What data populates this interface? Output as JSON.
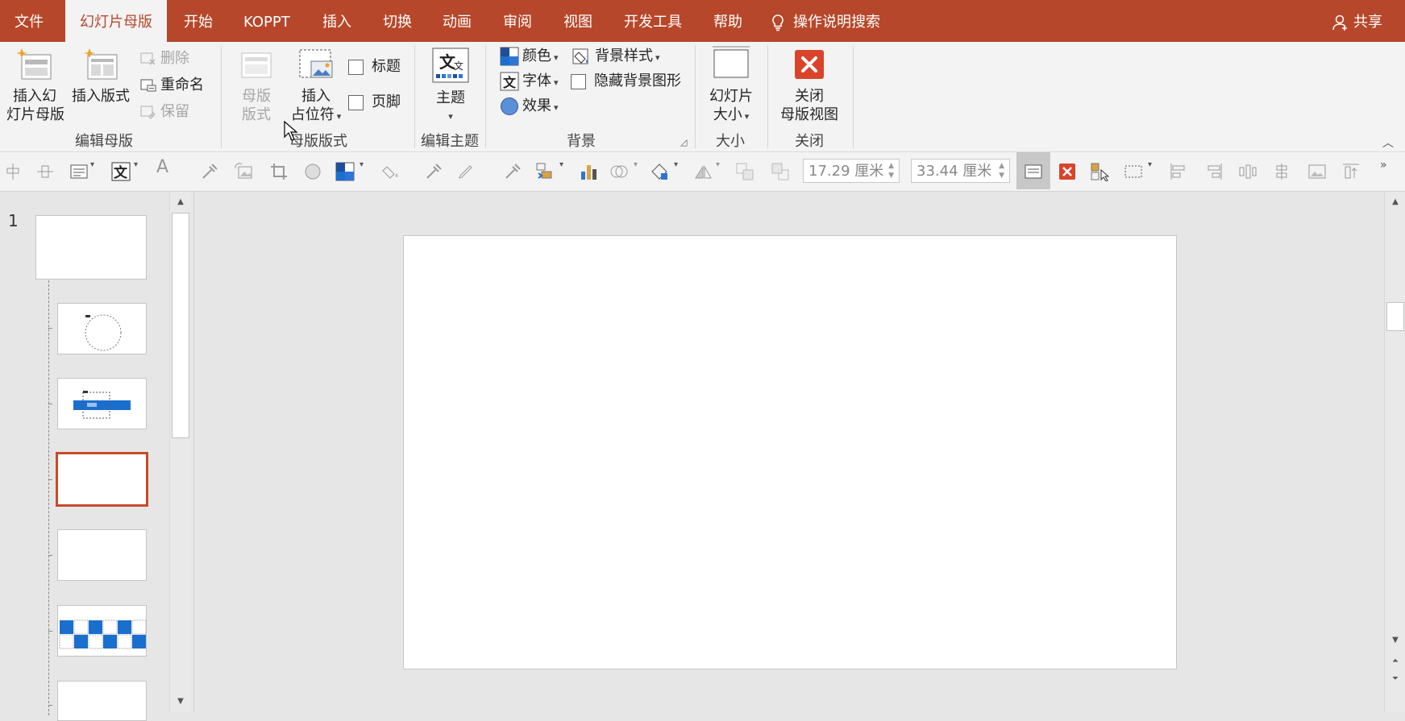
{
  "tabs": [
    {
      "label": "文件",
      "active": false
    },
    {
      "label": "幻灯片母版",
      "active": true
    },
    {
      "label": "开始",
      "active": false
    },
    {
      "label": "KOPPT",
      "active": false
    },
    {
      "label": "插入",
      "active": false
    },
    {
      "label": "切换",
      "active": false
    },
    {
      "label": "动画",
      "active": false
    },
    {
      "label": "审阅",
      "active": false
    },
    {
      "label": "视图",
      "active": false
    },
    {
      "label": "开发工具",
      "active": false
    },
    {
      "label": "帮助",
      "active": false
    }
  ],
  "search": {
    "label": "操作说明搜索",
    "icon": "lightbulb-icon"
  },
  "share": {
    "label": "共享",
    "icon": "person-icon"
  },
  "ribbon": {
    "edit_master": {
      "label": "编辑母版",
      "insert_master": [
        "插入幻",
        "灯片母版"
      ],
      "insert_layout": "插入版式",
      "delete": "删除",
      "rename": "重命名",
      "preserve": "保留"
    },
    "master_layout": {
      "label": "母版版式",
      "master_layout_btn": [
        "母版",
        "版式"
      ],
      "insert_placeholder": [
        "插入",
        "占位符"
      ],
      "title_checkbox": "标题",
      "footer_checkbox": "页脚"
    },
    "edit_theme": {
      "label": "编辑主题",
      "theme": "主题"
    },
    "background": {
      "label": "背景",
      "colors": "颜色",
      "fonts": "字体",
      "effects": "效果",
      "bg_styles": "背景样式",
      "hide_bg": "隐藏背景图形"
    },
    "size": {
      "label": "大小",
      "slide_size": [
        "幻灯片",
        "大小"
      ]
    },
    "close": {
      "label": "关闭",
      "close_master": [
        "关闭",
        "母版视图"
      ]
    }
  },
  "toolbar": {
    "height_value": "17.29 厘米",
    "width_value": "33.44 厘米"
  },
  "thumbnails": {
    "number": "1"
  },
  "colors": {
    "accent": "#b7472a",
    "selected_border": "#c84a2b",
    "slide_blue": "#1a6fce"
  }
}
